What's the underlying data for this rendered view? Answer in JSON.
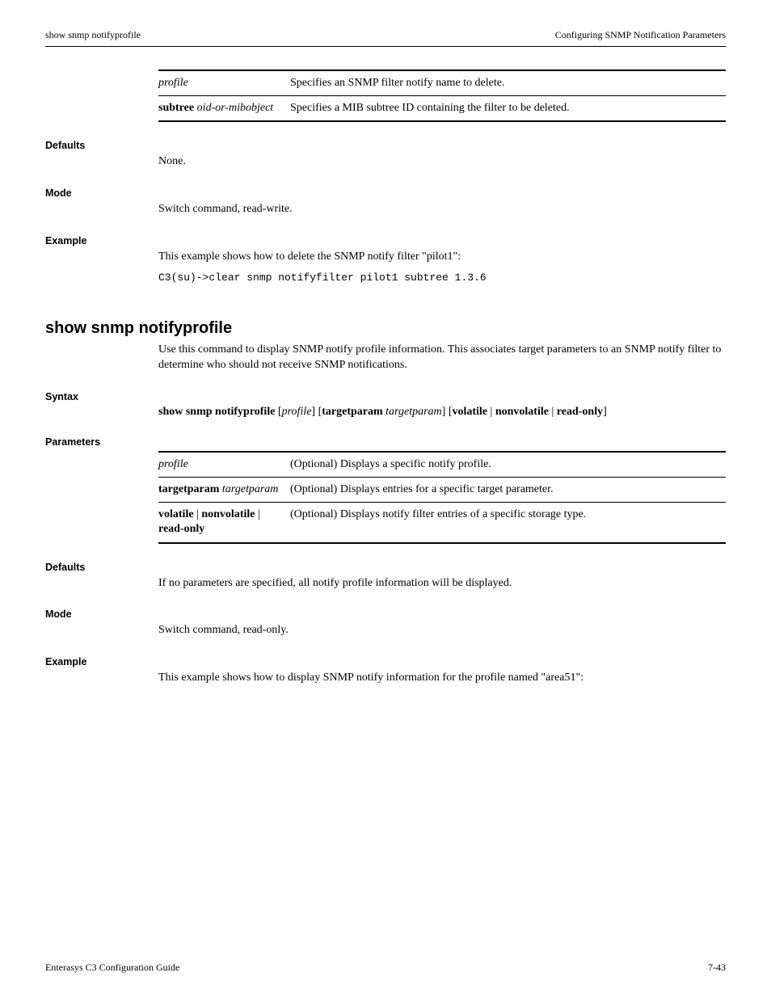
{
  "running_head": {
    "left": "show snmp notifyprofile",
    "right": "Configuring SNMP Notification Parameters"
  },
  "sec1": {
    "param_rows": [
      {
        "param_html": "<span class='ital'>profile</span>",
        "desc": "Specifies an SNMP filter notify name to delete."
      },
      {
        "param_html": "<span class='bold'>subtree</span> <span class='ital'>oid-or-mibobject</span>",
        "desc": "Specifies a MIB subtree ID containing the filter to be deleted."
      }
    ],
    "defaults_label": "Defaults",
    "defaults_text": "None.",
    "mode_label": "Mode",
    "mode_text": "Switch command, read-write.",
    "example_label": "Example",
    "example_text": "This example shows how to delete the SNMP notify filter \"pilot1\":",
    "example_code": "C3(su)->clear snmp notifyfilter pilot1 subtree 1.3.6"
  },
  "cmd2": {
    "name": "show snmp notifyprofile",
    "desc": "Use this command to display SNMP notify profile information. This associates target parameters to an SNMP notify filter to determine who should not receive SNMP notifications.",
    "syntax_label": "Syntax",
    "syntax_html": "<span class='kw'>show snmp notifyprofile</span> [<span class='arg'>profile</span>] [<span class='kw'>targetparam</span> <span class='arg'>targetparam</span>] [<span class='kw'>volatile</span> | <span class='kw'>nonvolatile</span> | <span class='kw'>read-only</span>]",
    "params_label": "Parameters",
    "param_rows": [
      {
        "param_html": "<span class='ital'>profile</span>",
        "desc": "(Optional) Displays a specific notify profile."
      },
      {
        "param_html": "<span class='bold'>targetparam</span> <span class='ital'>targetparam</span>",
        "desc": "(Optional) Displays entries for a specific target parameter."
      },
      {
        "param_html": "<span class='bold'>volatile</span> | <span class='bold'>nonvolatile</span> | <span class='bold'>read-only</span>",
        "desc": "(Optional) Displays notify filter entries of a specific storage type."
      }
    ],
    "defaults_label": "Defaults",
    "defaults_text": "If no parameters are specified, all notify profile information will be displayed.",
    "mode_label": "Mode",
    "mode_text": "Switch command, read-only.",
    "example_label": "Example",
    "example_text": "This example shows how to display SNMP notify information for the profile named \"area51\":"
  },
  "footer": {
    "left": "Enterasys C3 Configuration Guide",
    "right": "7-43"
  }
}
